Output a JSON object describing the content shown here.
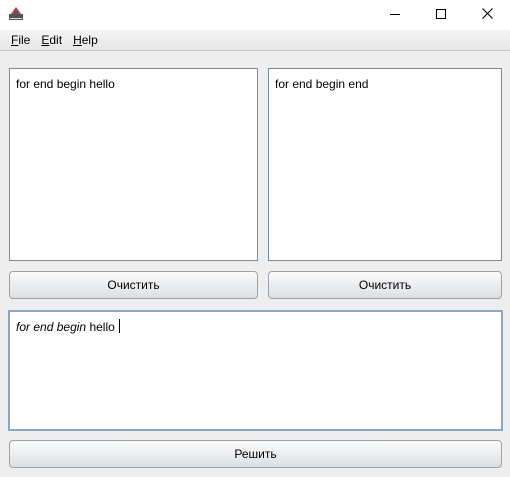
{
  "menu": {
    "file": {
      "mnemonic": "F",
      "rest": "ile"
    },
    "edit": {
      "mnemonic": "E",
      "rest": "dit"
    },
    "help": {
      "mnemonic": "H",
      "rest": "elp"
    }
  },
  "left_input": {
    "value": "for end begin hello"
  },
  "right_input": {
    "value": "for end begin end"
  },
  "left_clear_label": "Очистить",
  "right_clear_label": "Очистить",
  "result": {
    "kw1": "for",
    "kw2": "end",
    "kw3": "begin",
    "plain": "hello"
  },
  "solve_label": "Решить",
  "icons": {
    "app": "java-app-icon",
    "minimize": "minimize-icon",
    "maximize": "maximize-icon",
    "close": "close-icon"
  }
}
